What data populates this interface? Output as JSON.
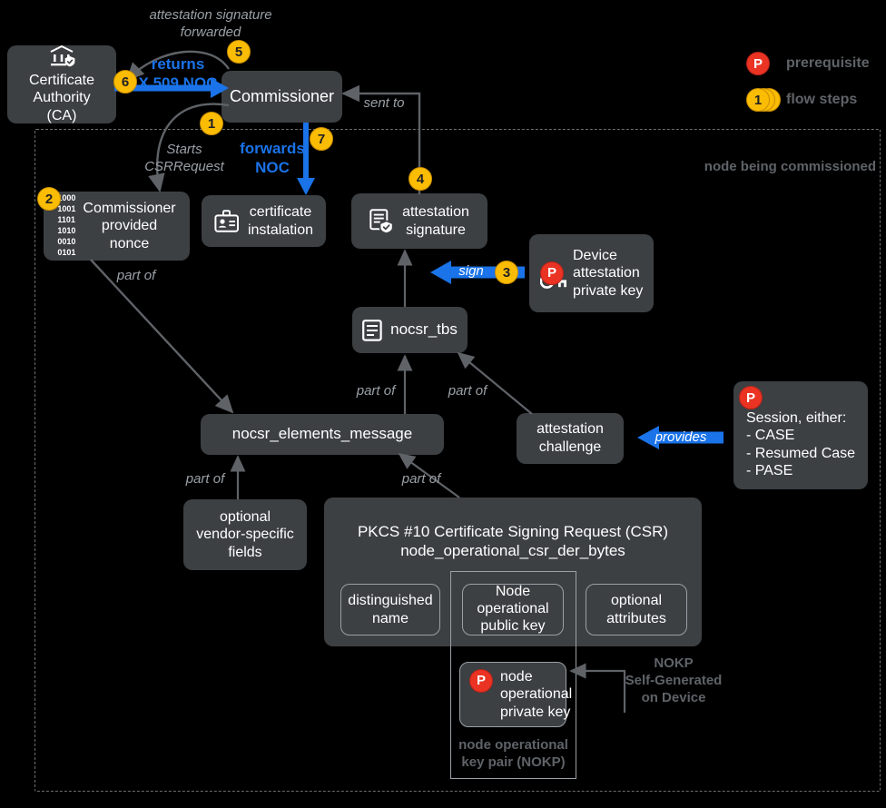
{
  "diagram": {
    "region_label": "node being commissioned"
  },
  "legend": {
    "prerequisite": {
      "badge": "P",
      "label": "prerequisite"
    },
    "flow": {
      "badge": "1",
      "label": "flow steps"
    }
  },
  "nodes": {
    "ca": {
      "label": "Certificate\nAuthority (CA)",
      "icon": "bank-shield-icon"
    },
    "commissioner": {
      "label": "Commissioner"
    },
    "nonce": {
      "label": "Commissioner\nprovided\nnonce",
      "binary": "1000\n1001\n1101\n1010\n0010\n0101",
      "badge": "2"
    },
    "cert_install": {
      "label": "certificate\ninstalation",
      "icon": "id-badge-icon"
    },
    "attestation_signature": {
      "label": "attestation\nsignature",
      "icon": "document-shield-icon",
      "badge": "4"
    },
    "device_key": {
      "label": "Device\nattestation\nprivate key",
      "icon": "key-icon",
      "badge": "P"
    },
    "nocsr_tbs": {
      "label": "nocsr_tbs",
      "icon": "document-icon"
    },
    "nocsr_elements_message": {
      "label": "nocsr_elements_message"
    },
    "attestation_challenge": {
      "label": "attestation\nchallenge"
    },
    "session": {
      "label": "Session, either:\n- CASE\n- Resumed Case\n- PASE",
      "badge": "P"
    },
    "vendor_fields": {
      "label": "optional\nvendor-specific\nfields"
    },
    "csr": {
      "title_line1": "PKCS #10 Certificate Signing Request (CSR)",
      "title_line2": "node_operational_csr_der_bytes",
      "distinguished_name": "distinguished\nname",
      "node_public_key": "Node\noperational\npublic key",
      "optional_attributes": "optional\nattributes"
    },
    "node_private_key": {
      "label": "node\noperational\nprivate key",
      "badge": "P"
    },
    "nokp_group": {
      "label": "node operational\nkey pair (NOKP)"
    }
  },
  "edges": {
    "attestation_forwarded": "attestation signature\nforwarded",
    "returns_noc": "returns\nX.509 NOC",
    "returns_noc_badge": "6",
    "attestation_forwarded_badge": "5",
    "starts_csrrequest": "Starts\nCSRRequest",
    "starts_csrrequest_badge": "1",
    "forwards_noc": "forwards\nNOC",
    "forwards_noc_badge": "7",
    "sent_to": "sent to",
    "sign": "sign",
    "sign_badge": "3",
    "provides": "provides",
    "part_of": "part of",
    "nokp_self_generated": "NOKP\nSelf-Generated\non Device"
  },
  "colors": {
    "background": "#000000",
    "node_fill": "#3c4043",
    "accent_blue": "#1a73e8",
    "badge_yellow": "#fbbc04",
    "badge_red": "#ea3323",
    "muted_text": "#9aa0a6"
  }
}
